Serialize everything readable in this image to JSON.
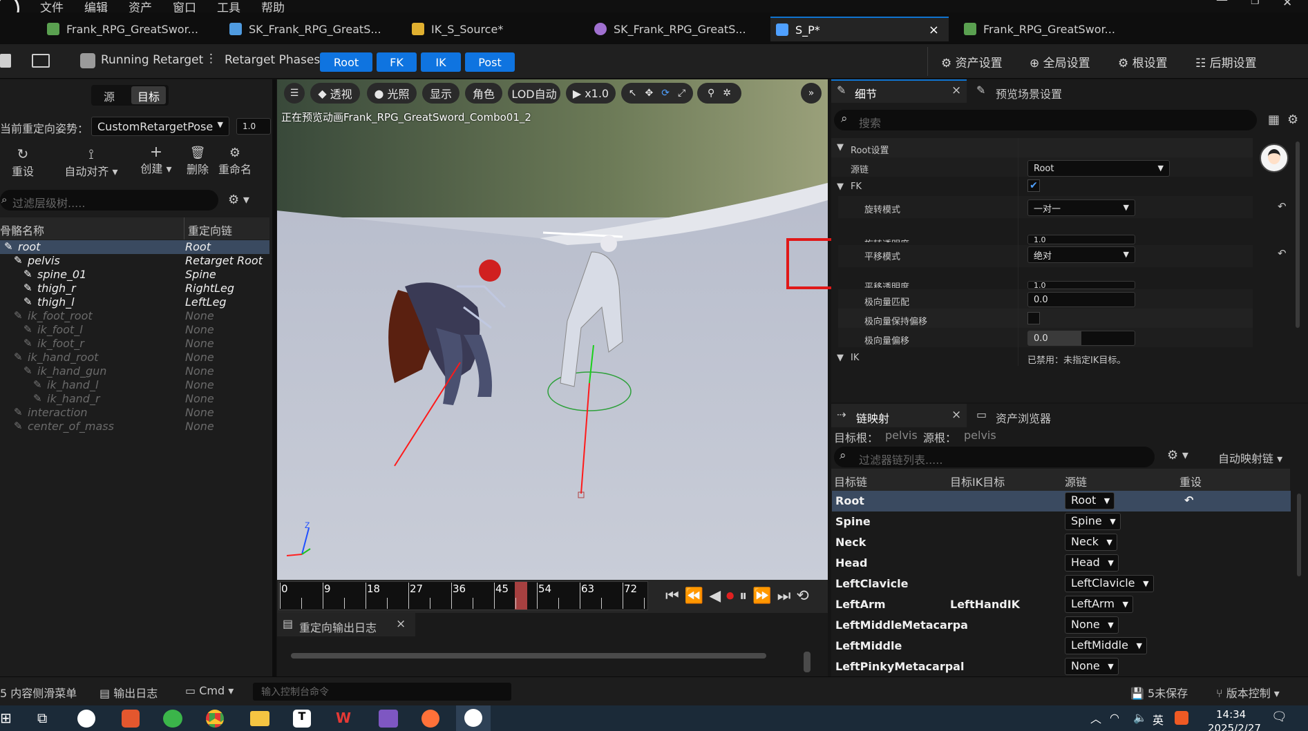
{
  "menu": [
    "文件",
    "编辑",
    "资产",
    "窗口",
    "工具",
    "帮助"
  ],
  "tabs": [
    {
      "label": "Frank_RPG_GreatSwor...",
      "color": "#5aa050"
    },
    {
      "label": "SK_Frank_RPG_GreatS...",
      "color": "#4f9be0"
    },
    {
      "label": "IK_S_Source*",
      "color": "#e0b030"
    },
    {
      "label": "SK_Frank_RPG_GreatS...",
      "color": "#a070d0"
    },
    {
      "label": "S_P*",
      "color": "#4fa0ff",
      "close": "×"
    },
    {
      "label": "Frank_RPG_GreatSwor...",
      "color": "#5aa050"
    }
  ],
  "toolbar": {
    "running": "Running Retarget",
    "phases_label": "Retarget Phases:",
    "phases": [
      "Root",
      "FK",
      "IK",
      "Post"
    ],
    "right": [
      "资产设置",
      "全局设置",
      "根设置",
      "后期设置"
    ]
  },
  "left": {
    "src_tab": "源",
    "target_tab": "目标",
    "pose_label": "当前重定向姿势：",
    "pose_value": "CustomRetargetPose",
    "pose_num": "1.0",
    "actions": [
      "重设",
      "自动对齐",
      "创建",
      "删除",
      "重命名"
    ],
    "filter_placeholder": "过滤层级树.....",
    "col_bone": "骨骼名称",
    "col_chain": "重定向链",
    "rows": [
      {
        "bone": "root",
        "chain": "Root",
        "indent": 0,
        "sel": true,
        "dim": false
      },
      {
        "bone": "pelvis",
        "chain": "Retarget Root",
        "indent": 1,
        "dim": false
      },
      {
        "bone": "spine_01",
        "chain": "Spine",
        "indent": 2,
        "dim": false
      },
      {
        "bone": "thigh_r",
        "chain": "RightLeg",
        "indent": 2,
        "dim": false
      },
      {
        "bone": "thigh_l",
        "chain": "LeftLeg",
        "indent": 2,
        "dim": false
      },
      {
        "bone": "ik_foot_root",
        "chain": "None",
        "indent": 1,
        "dim": true
      },
      {
        "bone": "ik_foot_l",
        "chain": "None",
        "indent": 2,
        "dim": true
      },
      {
        "bone": "ik_foot_r",
        "chain": "None",
        "indent": 2,
        "dim": true
      },
      {
        "bone": "ik_hand_root",
        "chain": "None",
        "indent": 1,
        "dim": true
      },
      {
        "bone": "ik_hand_gun",
        "chain": "None",
        "indent": 2,
        "dim": true
      },
      {
        "bone": "ik_hand_l",
        "chain": "None",
        "indent": 3,
        "dim": true
      },
      {
        "bone": "ik_hand_r",
        "chain": "None",
        "indent": 3,
        "dim": true
      },
      {
        "bone": "interaction",
        "chain": "None",
        "indent": 1,
        "dim": true
      },
      {
        "bone": "center_of_mass",
        "chain": "None",
        "indent": 1,
        "dim": true
      }
    ]
  },
  "viewport": {
    "buttons": [
      "透视",
      "光照",
      "显示",
      "角色",
      "LOD自动",
      "x1.0"
    ],
    "overlay": "正在预览动画Frank_RPG_GreatSword_Combo01_2",
    "axis_z": "Z",
    "timeline": [
      "0",
      "9",
      "18",
      "27",
      "36",
      "45",
      "54",
      "63",
      "72"
    ]
  },
  "output_log": {
    "title": "重定向输出日志",
    "close": "×"
  },
  "details": {
    "tab1": "细节",
    "tab2": "预览场景设置",
    "close": "×",
    "search": "搜索",
    "section": "Root设置",
    "src_chain_label": "源链",
    "src_chain_value": "Root",
    "fk_label": "FK",
    "rot_mode_label": "旋转模式",
    "rot_mode_value": "一对一",
    "rot_alpha_label": "旋转透明度",
    "rot_alpha_value": "1.0",
    "trans_mode_label": "平移模式",
    "trans_mode_value": "绝对",
    "trans_alpha_label": "平移透明度",
    "trans_alpha_value": "1.0",
    "pole_match_label": "极向量匹配",
    "pole_match_value": "0.0",
    "pole_keep_label": "极向量保持偏移",
    "pole_offset_label": "极向量偏移",
    "pole_offset_value": "0.0",
    "ik_label": "IK",
    "ik_value": "已禁用：未指定IK目标。"
  },
  "chain_map": {
    "tab1": "链映射",
    "tab2": "资产浏览器",
    "close": "×",
    "target_root_label": "目标根：",
    "target_root": "pelvis",
    "source_root_label": "源根：",
    "source_root": "pelvis",
    "filter": "过滤器链列表.....",
    "auto_map": "自动映射链",
    "cols": [
      "目标链",
      "目标IK目标",
      "源链",
      "重设"
    ],
    "rows": [
      {
        "target": "Root",
        "ik": "",
        "source": "Root",
        "sel": true
      },
      {
        "target": "Spine",
        "ik": "",
        "source": "Spine"
      },
      {
        "target": "Neck",
        "ik": "",
        "source": "Neck"
      },
      {
        "target": "Head",
        "ik": "",
        "source": "Head"
      },
      {
        "target": "LeftClavicle",
        "ik": "",
        "source": "LeftClavicle"
      },
      {
        "target": "LeftArm",
        "ik": "LeftHandIK",
        "source": "LeftArm"
      },
      {
        "target": "LeftMiddleMetacarpa",
        "ik": "",
        "source": "None"
      },
      {
        "target": "LeftMiddle",
        "ik": "",
        "source": "LeftMiddle"
      },
      {
        "target": "LeftPinkyMetacarpal",
        "ik": "",
        "source": "None"
      }
    ]
  },
  "status": {
    "drawer": "内容侧滑菜单",
    "log": "输出日志",
    "cmd": "Cmd",
    "console_placeholder": "输入控制台命令",
    "unsaved": "5未保存",
    "vc": "版本控制"
  },
  "taskbar": {
    "time": "14:34",
    "date": "2025/2/27",
    "lang": "英"
  }
}
